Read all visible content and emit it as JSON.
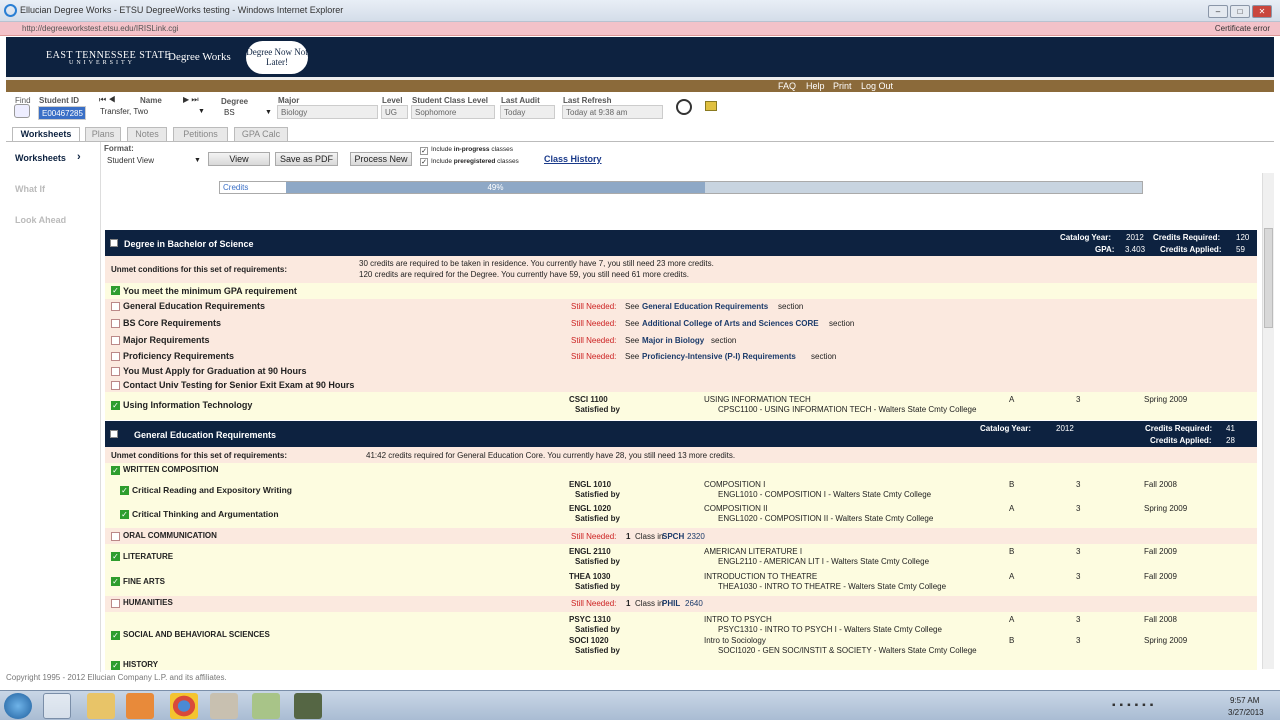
{
  "window": {
    "title": "Ellucian Degree Works - ETSU DegreeWorks testing - Windows Internet Explorer",
    "url": "http://degreeworkstest.etsu.edu/IRISLink.cgi",
    "cert": "Certificate error"
  },
  "header": {
    "univ_line1": "EAST TENNESSEE STATE",
    "univ_line2": "UNIVERSITY",
    "app": "Degree Works",
    "badge": "Degree Now Not Later!"
  },
  "menu": {
    "faq": "FAQ",
    "help": "Help",
    "print": "Print",
    "logout": "Log Out"
  },
  "student": {
    "find_label": "Find",
    "id_label": "Student ID",
    "id": "E00467285",
    "name_label": "Name",
    "name": "Transfer, Two",
    "degree_label": "Degree",
    "degree": "BS",
    "major_label": "Major",
    "major": "Biology",
    "level_label": "Level",
    "level": "UG",
    "class_label": "Student Class Level",
    "class": "Sophomore",
    "audit_label": "Last Audit",
    "audit": "Today",
    "refresh_label": "Last Refresh",
    "refresh": "Today at 9:38 am"
  },
  "tabs": {
    "worksheets": "Worksheets",
    "plans": "Plans",
    "notes": "Notes",
    "petitions": "Petitions",
    "gpa": "GPA Calc"
  },
  "side": {
    "worksheets": "Worksheets",
    "whatif": "What If",
    "lookahead": "Look Ahead"
  },
  "toolbar": {
    "format_label": "Format:",
    "format": "Student View",
    "view": "View",
    "pdf": "Save as PDF",
    "process": "Process New",
    "inprog_pre": "Include ",
    "inprog_b": "in-progress",
    "inprog_post": " classes",
    "prereg_pre": "Include ",
    "prereg_b": "preregistered",
    "prereg_post": " classes",
    "history": "Class History"
  },
  "progress": {
    "label": "Credits",
    "text": "49%",
    "value": 0.49
  },
  "degree_block": {
    "title": "Degree in Bachelor of Science",
    "catalog_label": "Catalog Year:",
    "catalog": "2012",
    "credits_req_label": "Credits Required:",
    "credits_req": "120",
    "gpa_label": "GPA:",
    "gpa": "3.403",
    "credits_applied_label": "Credits Applied:",
    "credits_applied": "59",
    "unmet_label": "Unmet conditions for this set of requirements:",
    "unmet1": "30 credits are required to be taken in residence. You currently have 7, you still need 23 more credits.",
    "unmet2": "120 credits are required for the Degree. You currently have 59, you still need 61 more credits.",
    "gpa_req": "You meet the minimum GPA requirement",
    "still": "Still Needed:",
    "see": "See",
    "section": "section",
    "reqs": [
      {
        "name": "General Education Requirements",
        "link": "General Education Requirements"
      },
      {
        "name": "BS Core Requirements",
        "link": "Additional College of Arts and Sciences CORE"
      },
      {
        "name": "Major Requirements",
        "link": "Major in Biology"
      },
      {
        "name": "Proficiency Requirements",
        "link": "Proficiency-Intensive (P-I) Requirements"
      }
    ],
    "apply": "You Must Apply for Graduation at 90 Hours",
    "exit": "Contact Univ Testing for Senior Exit Exam at 90 Hours",
    "it": {
      "name": "Using Information Technology",
      "course": "CSCI 1100",
      "satisfied": "Satisfied by",
      "title": "USING INFORMATION TECH",
      "detail": "CPSC1100 - USING INFORMATION TECH - Walters State Cmty College",
      "grade": "A",
      "credits": "3",
      "term": "Spring 2009"
    }
  },
  "gen_ed": {
    "title": "General Education Requirements",
    "catalog_label": "Catalog Year:",
    "catalog": "2012",
    "credits_req_label": "Credits Required:",
    "credits_req": "41",
    "credits_applied_label": "Credits Applied:",
    "credits_applied": "28",
    "unmet_label": "Unmet conditions for this set of requirements:",
    "unmet": "41:42 credits required for General Education Core. You currently have 28, you still need 13 more credits.",
    "written": "WRITTEN COMPOSITION",
    "crit_read": {
      "name": "Critical Reading and Expository Writing",
      "course": "ENGL 1010",
      "satisfied": "Satisfied by",
      "title": "COMPOSITION I",
      "detail": "ENGL1010 - COMPOSITION I - Walters State Cmty College",
      "grade": "B",
      "credits": "3",
      "term": "Fall 2008"
    },
    "crit_think": {
      "name": "Critical Thinking and Argumentation",
      "course": "ENGL 1020",
      "satisfied": "Satisfied by",
      "title": "COMPOSITION II",
      "detail": "ENGL1020 - COMPOSITION II - Walters State Cmty College",
      "grade": "A",
      "credits": "3",
      "term": "Spring 2009"
    },
    "oral": {
      "name": "ORAL COMMUNICATION",
      "still": "Still Needed:",
      "one": "1",
      "class_in": "Class in",
      "subj": "SPCH",
      "num": "2320"
    },
    "lit": {
      "name": "LITERATURE",
      "course": "ENGL 2110",
      "satisfied": "Satisfied by",
      "title": "AMERICAN LITERATURE I",
      "detail": "ENGL2110 - AMERICAN LIT I - Walters State Cmty College",
      "grade": "B",
      "credits": "3",
      "term": "Fall 2009"
    },
    "fine": {
      "name": "FINE ARTS",
      "course": "THEA 1030",
      "satisfied": "Satisfied by",
      "title": "INTRODUCTION TO THEATRE",
      "detail": "THEA1030 - INTRO TO THEATRE - Walters State Cmty College",
      "grade": "A",
      "credits": "3",
      "term": "Fall 2009"
    },
    "hum": {
      "name": "HUMANITIES",
      "still": "Still Needed:",
      "one": "1",
      "class_in": "Class in",
      "subj": "PHIL",
      "num": "2640"
    },
    "social": {
      "name": "SOCIAL AND BEHAVIORAL SCIENCES",
      "c1": {
        "course": "PSYC 1310",
        "satisfied": "Satisfied by",
        "title": "INTRO TO PSYCH",
        "detail": "PSYC1310 - INTRO TO PSYCH I - Walters State Cmty College",
        "grade": "A",
        "credits": "3",
        "term": "Fall 2008"
      },
      "c2": {
        "course": "SOCI 1020",
        "satisfied": "Satisfied by",
        "title": "Intro to Sociology",
        "detail": "SOCI1020 - GEN SOC/INSTIT & SOCIETY - Walters State Cmty College",
        "grade": "B",
        "credits": "3",
        "term": "Spring 2009"
      }
    },
    "history": "HISTORY"
  },
  "footer": "Copyright 1995 - 2012 Ellucian Company L.P. and its affiliates.",
  "clock": {
    "time": "9:57 AM",
    "date": "3/27/2013"
  }
}
